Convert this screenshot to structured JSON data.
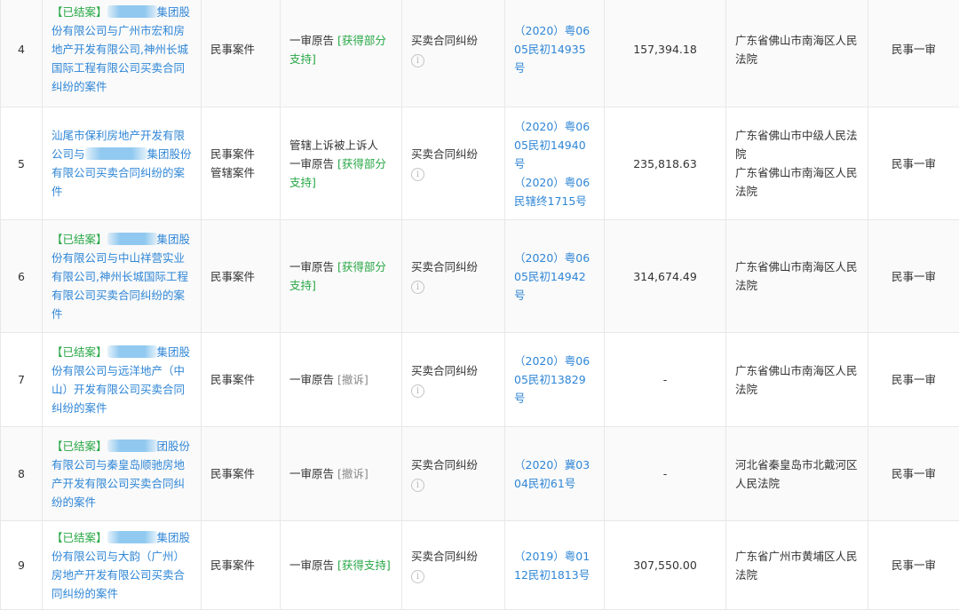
{
  "rows": [
    {
      "index": "4",
      "status": "【已结案】",
      "title_before": "",
      "title_after": "集团股份有限公司与广州市宏和房地产开发有限公司,神州长城国际工程有限公司买卖合同纠纷的案件",
      "case_types": [
        "民事案件"
      ],
      "roles": [
        {
          "text": "一审原告 ",
          "result": "[获得部分支持]",
          "result_color": "green"
        }
      ],
      "cause": "买卖合同纠纷",
      "case_numbers": [
        "（2020）粤0605民初14935号"
      ],
      "amount": "157,394.18",
      "courts": [
        "广东省佛山市南海区人民法院"
      ],
      "trial": "民事一审"
    },
    {
      "index": "5",
      "status": "",
      "title_before": "汕尾市保利房地产开发有限公司与",
      "title_after": "集团股份有限公司买卖合同纠纷的案件",
      "case_types": [
        "民事案件",
        "管辖案件"
      ],
      "roles": [
        {
          "text": "管辖上诉被上诉人",
          "result": "",
          "result_color": ""
        },
        {
          "text": "一审原告 ",
          "result": "[获得部分支持]",
          "result_color": "green"
        }
      ],
      "cause": "买卖合同纠纷",
      "case_numbers": [
        "（2020）粤0605民初14940号",
        "（2020）粤06民辖终1715号"
      ],
      "amount": "235,818.63",
      "courts": [
        "广东省佛山市中级人民法院",
        "广东省佛山市南海区人民法院"
      ],
      "trial": "民事一审"
    },
    {
      "index": "6",
      "status": "【已结案】",
      "title_before": "",
      "title_after": "集团股份有限公司与中山祥营实业有限公司,神州长城国际工程有限公司买卖合同纠纷的案件",
      "case_types": [
        "民事案件"
      ],
      "roles": [
        {
          "text": "一审原告 ",
          "result": "[获得部分支持]",
          "result_color": "green"
        }
      ],
      "cause": "买卖合同纠纷",
      "case_numbers": [
        "（2020）粤0605民初14942号"
      ],
      "amount": "314,674.49",
      "courts": [
        "广东省佛山市南海区人民法院"
      ],
      "trial": "民事一审"
    },
    {
      "index": "7",
      "status": "【已结案】",
      "title_before": "",
      "title_after": "集团股份有限公司与远洋地产（中山）开发有限公司买卖合同纠纷的案件",
      "case_types": [
        "民事案件"
      ],
      "roles": [
        {
          "text": "一审原告 ",
          "result": "[撤诉]",
          "result_color": "gray"
        }
      ],
      "cause": "买卖合同纠纷",
      "case_numbers": [
        "（2020）粤0605民初13829号"
      ],
      "amount": "-",
      "courts": [
        "广东省佛山市南海区人民法院"
      ],
      "trial": "民事一审"
    },
    {
      "index": "8",
      "status": "【已结案】",
      "title_before": "",
      "title_after": "团股份有限公司与秦皇岛顺驰房地产开发有限公司买卖合同纠纷的案件",
      "case_types": [
        "民事案件"
      ],
      "roles": [
        {
          "text": "一审原告 ",
          "result": "[撤诉]",
          "result_color": "gray"
        }
      ],
      "cause": "买卖合同纠纷",
      "case_numbers": [
        "（2020）冀0304民初61号"
      ],
      "amount": "-",
      "courts": [
        "河北省秦皇岛市北戴河区人民法院"
      ],
      "trial": "民事一审"
    },
    {
      "index": "9",
      "status": "【已结案】",
      "title_before": "",
      "title_after": "集团股份有限公司与大韵（广州）房地产开发有限公司买卖合同纠纷的案件",
      "case_types": [
        "民事案件"
      ],
      "roles": [
        {
          "text": "一审原告 ",
          "result": "[获得支持]",
          "result_color": "green"
        }
      ],
      "cause": "买卖合同纠纷",
      "case_numbers": [
        "（2019）粤0112民初1813号"
      ],
      "amount": "307,550.00",
      "courts": [
        "广东省广州市黄埔区人民法院"
      ],
      "trial": "民事一审"
    }
  ],
  "info_icon_glyph": "i",
  "colors": {
    "link": "#2f86d6",
    "green": "#27a745",
    "gray": "#888888",
    "border": "#e8e8e8"
  }
}
